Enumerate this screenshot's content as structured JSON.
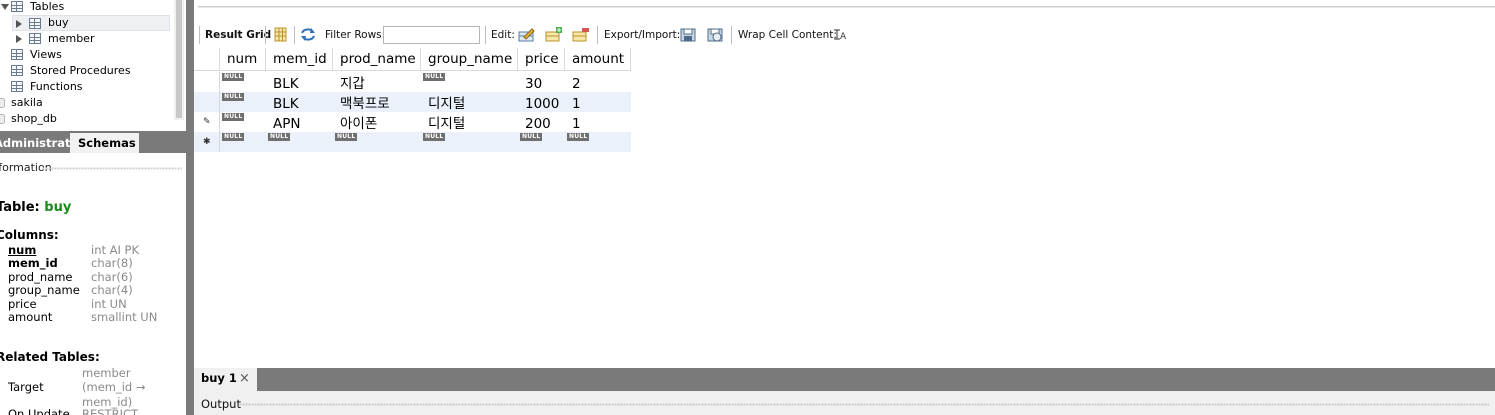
{
  "navigator": {
    "tree": [
      {
        "label": "Tables",
        "kind": "folder",
        "state": "expanded"
      },
      {
        "label": "buy",
        "kind": "table",
        "state": "collapsed",
        "selected": true
      },
      {
        "label": "member",
        "kind": "table",
        "state": "collapsed"
      },
      {
        "label": "Views",
        "kind": "folder"
      },
      {
        "label": "Stored Procedures",
        "kind": "folder"
      },
      {
        "label": "Functions",
        "kind": "folder"
      },
      {
        "label": "sakila",
        "kind": "schema"
      },
      {
        "label": "shop_db",
        "kind": "schema"
      }
    ],
    "tabs": {
      "administration": "Administration",
      "schemas": "Schemas"
    },
    "info": {
      "header": "Information",
      "table_prefix": "Table:",
      "table_name": "buy",
      "columns_header": "Columns:",
      "columns": [
        {
          "name": "num",
          "type": "int AI PK",
          "style": "pk"
        },
        {
          "name": "mem_id",
          "type": "char(8)",
          "style": "bold"
        },
        {
          "name": "prod_name",
          "type": "char(6)",
          "style": "normal"
        },
        {
          "name": "group_name",
          "type": "char(4)",
          "style": "normal"
        },
        {
          "name": "price",
          "type": "int UN",
          "style": "normal"
        },
        {
          "name": "amount",
          "type": "smallint UN",
          "style": "normal"
        }
      ],
      "related_header": "Related Tables:",
      "related": {
        "target_label": "Target",
        "target_line1": "member",
        "target_line2": "(mem_id →",
        "target_line3": "mem_id)",
        "on_update_label": "On Update",
        "on_update_value": "RESTRICT"
      }
    }
  },
  "toolbar": {
    "result_grid": "Result Grid",
    "filter_rows": "Filter Rows:",
    "filter_value": "",
    "edit": "Edit:",
    "export_import": "Export/Import:",
    "wrap_cell": "Wrap Cell Content:",
    "icons": [
      "grid-layout-icon",
      "refresh-icon",
      "edit-row-icon",
      "add-row-icon",
      "delete-row-icon",
      "export-icon",
      "import-icon",
      "wrap-text-icon"
    ]
  },
  "grid": {
    "columns": [
      "num",
      "mem_id",
      "prod_name",
      "group_name",
      "price",
      "amount"
    ],
    "null_label": "NULL",
    "rows": [
      {
        "marker": "",
        "cells": [
          null,
          "BLK",
          "지갑",
          null,
          "30",
          "2"
        ]
      },
      {
        "marker": "",
        "cells": [
          null,
          "BLK",
          "맥북프로",
          "디지털",
          "1000",
          "1"
        ]
      },
      {
        "marker": "✎",
        "cells": [
          null,
          "APN",
          "아이폰",
          "디지털",
          "200",
          "1"
        ]
      },
      {
        "marker": "✱",
        "cells": [
          null,
          null,
          null,
          null,
          null,
          null
        ]
      }
    ]
  },
  "result_tab": {
    "label": "buy 1",
    "close": "×"
  },
  "output": {
    "label": "Output"
  }
}
